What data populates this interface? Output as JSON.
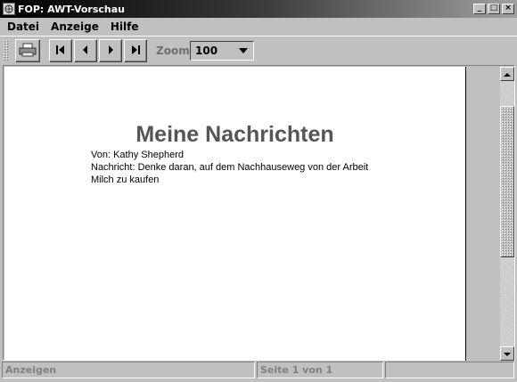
{
  "window": {
    "title": "FOP: AWT-Vorschau",
    "controls": {
      "minimize": "_",
      "maximize": "□",
      "close": "×"
    }
  },
  "menu": {
    "items": [
      "Datei",
      "Anzeige",
      "Hilfe"
    ]
  },
  "toolbar": {
    "buttons": [
      "print-icon",
      "first-page-icon",
      "prev-page-icon",
      "next-page-icon",
      "last-page-icon"
    ],
    "zoom_label": "Zoom",
    "zoom_value": "100"
  },
  "document": {
    "heading": "Meine Nachrichten",
    "lines": [
      "Von: Kathy Shepherd",
      "Nachricht: Denke daran, auf dem Nachhauseweg von der Arbeit",
      "Milch zu kaufen"
    ]
  },
  "status": {
    "mode": "Anzeigen",
    "page": "Seite 1 von 1",
    "extra": ""
  }
}
